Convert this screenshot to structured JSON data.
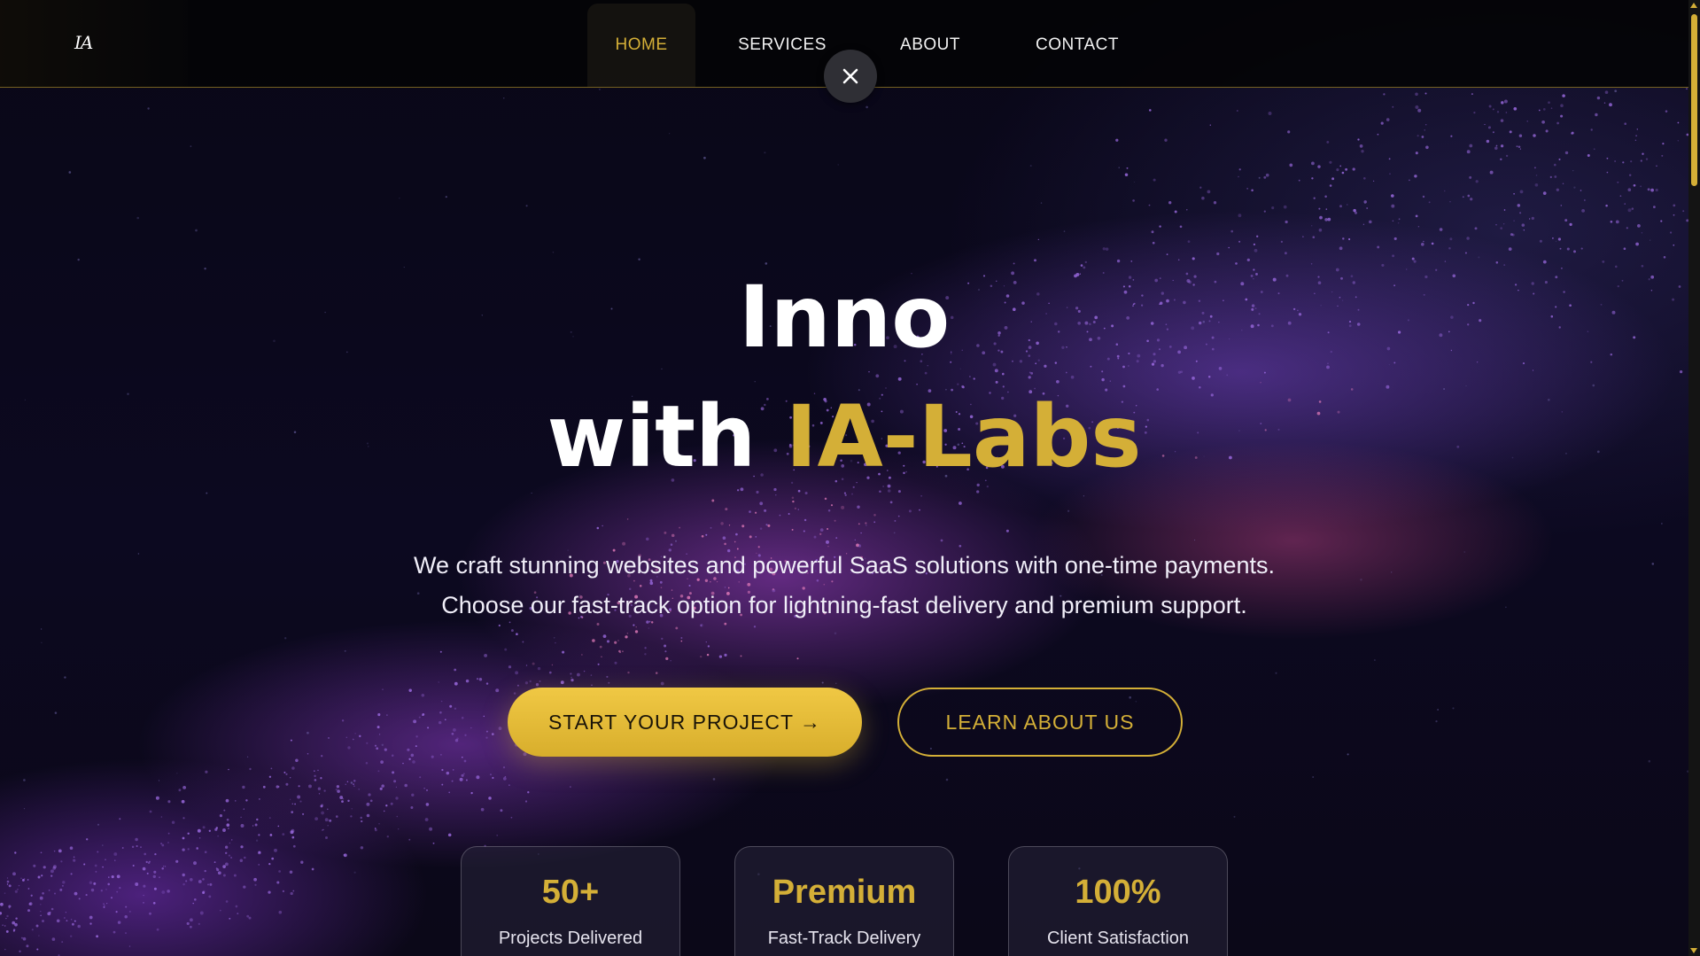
{
  "brand": {
    "logo_text": "IA"
  },
  "nav": {
    "items": [
      {
        "label": "HOME",
        "active": true
      },
      {
        "label": "SERVICES",
        "active": false
      },
      {
        "label": "ABOUT",
        "active": false
      },
      {
        "label": "CONTACT",
        "active": false
      }
    ],
    "close_icon": "close-icon"
  },
  "hero": {
    "title_line1": "Inno",
    "title_line2_prefix": "with ",
    "title_line2_accent": "IA-Labs",
    "subtitle_line1": "We craft stunning websites and powerful SaaS solutions with one-time payments.",
    "subtitle_line2": "Choose our fast-track option for lightning-fast delivery and premium support.",
    "primary_cta": "START YOUR PROJECT →",
    "secondary_cta": "LEARN ABOUT US"
  },
  "stats": [
    {
      "value": "50+",
      "label": "Projects Delivered"
    },
    {
      "value": "Premium",
      "label": "Fast-Track Delivery"
    },
    {
      "value": "100%",
      "label": "Client Satisfaction"
    }
  ],
  "colors": {
    "accent_gold": "#d4af37",
    "background": "#0c0920",
    "particle_purple": "#9b6ae0",
    "particle_pink": "#e07ab8"
  }
}
